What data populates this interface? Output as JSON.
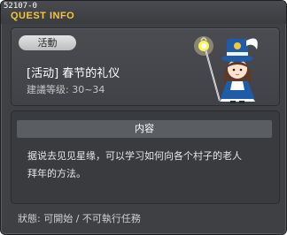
{
  "window": {
    "quest_id": "52107-0",
    "title": "QUEST INFO"
  },
  "quest": {
    "category_badge": "活動",
    "name": "[活动] 春节的礼仪",
    "level_requirement": "建議等级: 30~34",
    "npc_name": "npc-sprite"
  },
  "content": {
    "header": "内容",
    "body": "据说去见见星缘，可以学习如何向各个村子的老人\n拜年的方法。"
  },
  "footer": {
    "status": "狀態: 可開始 / 不可執行任務"
  },
  "colors": {
    "title_accent": "#f4c63c",
    "window_bg": "#3f4044"
  }
}
